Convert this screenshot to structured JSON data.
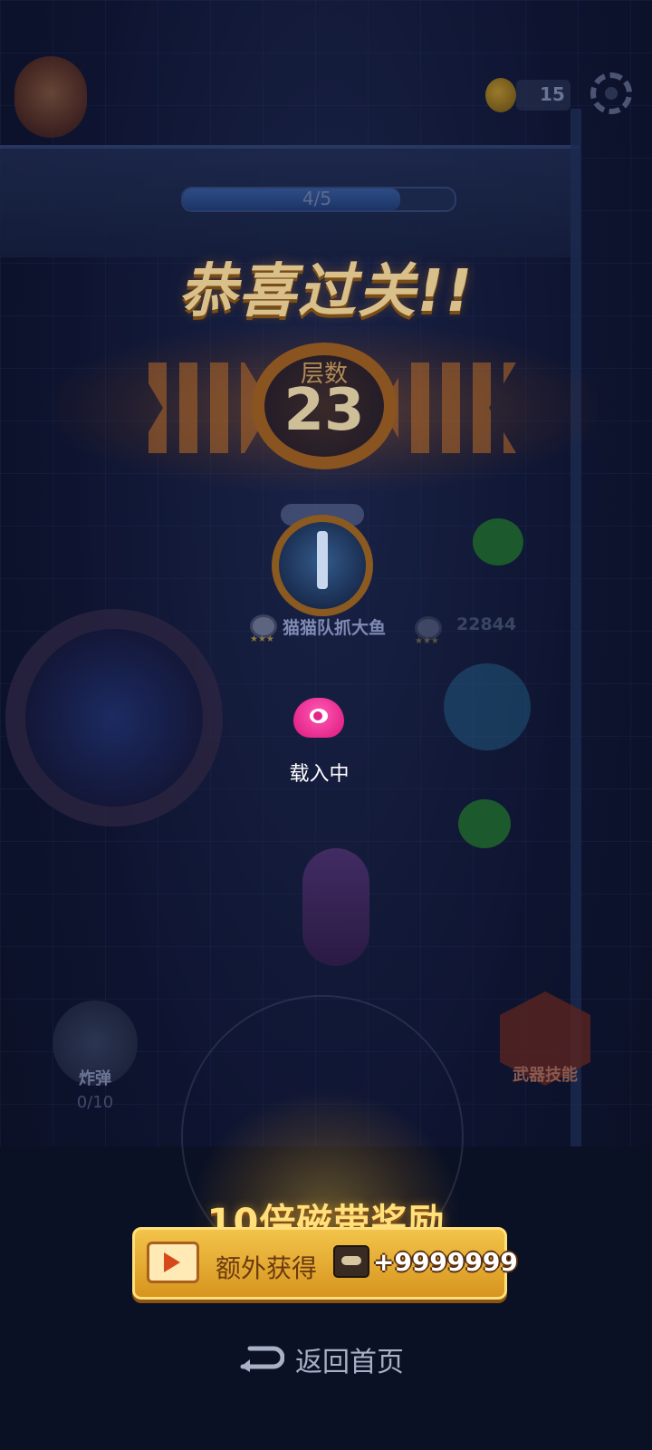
{
  "hud": {
    "coin_count": "15",
    "progress_label": "4/5",
    "progress_fraction": 0.8
  },
  "banner": {
    "title": "恭喜过关!!",
    "floor_label": "层数",
    "floor_number": "23"
  },
  "team": {
    "name": "猫猫队抓大鱼",
    "score": "22844"
  },
  "loading": {
    "text": "载入中"
  },
  "controls": {
    "bomb_label": "炸弹",
    "bomb_count": "0/10",
    "skill_label": "武器技能"
  },
  "reward": {
    "title": "10倍磁带奖励",
    "text": "额外获得",
    "amount": "+9999999"
  },
  "footer": {
    "back_label": "返回首页"
  },
  "colors": {
    "background": "#0b1022",
    "accent_gold": "#f2c34a",
    "loading_pink": "#e42488"
  }
}
